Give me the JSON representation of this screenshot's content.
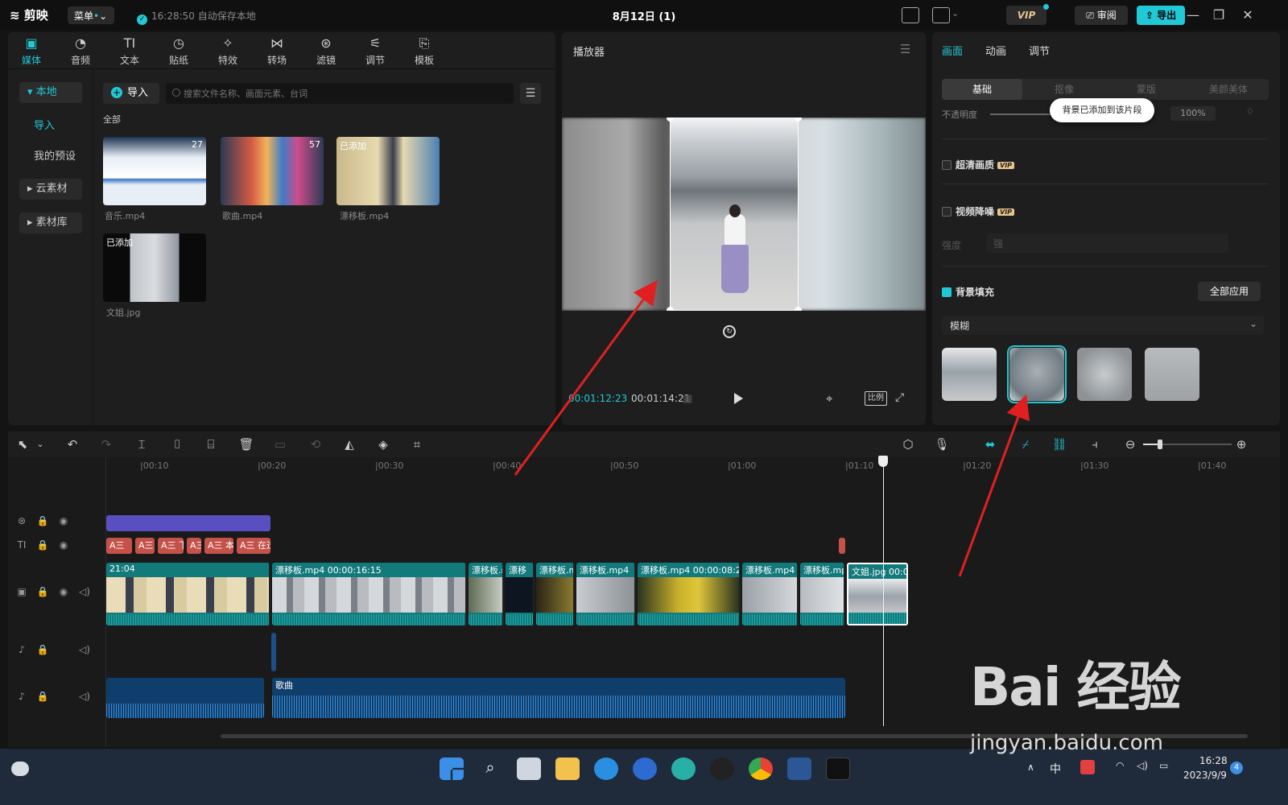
{
  "titlebar": {
    "app_name": "剪映",
    "menu_label": "菜单",
    "autosave_text": "16:28:50 自动保存本地",
    "project_title": "8月12日 (1)",
    "vip_label": "VIP",
    "review_label": "审阅",
    "export_label": "导出"
  },
  "media_tabs": [
    {
      "label": "媒体",
      "icon": "media-icon"
    },
    {
      "label": "音频",
      "icon": "audio-icon"
    },
    {
      "label": "文本",
      "icon": "text-icon",
      "glyph": "TI"
    },
    {
      "label": "贴纸",
      "icon": "sticker-icon"
    },
    {
      "label": "特效",
      "icon": "effects-icon"
    },
    {
      "label": "转场",
      "icon": "transition-icon"
    },
    {
      "label": "滤镜",
      "icon": "filter-icon"
    },
    {
      "label": "调节",
      "icon": "adjust-icon"
    },
    {
      "label": "模板",
      "icon": "template-icon"
    }
  ],
  "left_nav": {
    "local": "▾ 本地",
    "import": "导入",
    "presets": "我的预设",
    "cloud": "▸ 云素材",
    "library": "▸ 素材库"
  },
  "media_browser": {
    "import_label": "导入",
    "search_placeholder": "搜索文件名称、画面元素、台词",
    "all_label": "全部",
    "items": [
      {
        "name": "音乐.mp4",
        "duration": "27",
        "added": ""
      },
      {
        "name": "歌曲.mp4",
        "duration": "57",
        "added": ""
      },
      {
        "name": "漂移板.mp4",
        "duration": "",
        "added": "已添加"
      },
      {
        "name": "文姐.jpg",
        "duration": "",
        "added": "已添加"
      }
    ]
  },
  "player": {
    "title": "播放器",
    "current_time": "00:01:12:23",
    "total_time": "00:01:14:21",
    "ratio_label": "比例"
  },
  "properties": {
    "tabs": [
      "画面",
      "动画",
      "调节"
    ],
    "segments": [
      "基础",
      "抠像",
      "蒙版",
      "美颜美体"
    ],
    "opacity_label": "不透明度",
    "opacity_value": "100%",
    "toast": "背景已添加到该片段",
    "hd_label": "超清画质",
    "denoise_label": "视频降噪",
    "vip_tag": "VIP",
    "strength_label": "强度",
    "strength_value": "强",
    "bgfill_label": "背景填充",
    "apply_all_label": "全部应用",
    "blur_mode": "模糊",
    "swatch_count": 4,
    "selected_swatch": 2
  },
  "timeline": {
    "ruler": [
      "|00:10",
      "|00:20",
      "|00:30",
      "|00:40",
      "|00:50",
      "|01:00",
      "|01:10",
      "|01:20",
      "|01:30",
      "|01:40"
    ],
    "text_clips": [
      "A三",
      "A三",
      "A三 下",
      "A三",
      "A三 本",
      "A三 在过"
    ],
    "video_clips": [
      {
        "name": "21:04"
      },
      {
        "name": "漂移板.mp4  00:00:16:15"
      },
      {
        "name": "漂移板.r"
      },
      {
        "name": "漂移"
      },
      {
        "name": "漂移板.m"
      },
      {
        "name": "漂移板.mp4"
      },
      {
        "name": "漂移板.mp4  00:00:08:25"
      },
      {
        "name": "漂移板.mp4"
      },
      {
        "name": "漂移板.mp"
      },
      {
        "name": "文姐.jpg  00:0"
      }
    ],
    "audio_clip": "歌曲"
  },
  "taskbar": {
    "ime": "中",
    "time": "16:28",
    "date": "2023/9/9",
    "notif_count": "4"
  },
  "watermark": {
    "brand": "Bai  经验",
    "url": "jingyan.baidu.com"
  },
  "colors": {
    "accent": "#21c9d6",
    "video_track": "#137a7c",
    "audio_track": "#0f3e6b",
    "text_clip": "#c4524a",
    "sticker_track": "#5a4fc0"
  }
}
